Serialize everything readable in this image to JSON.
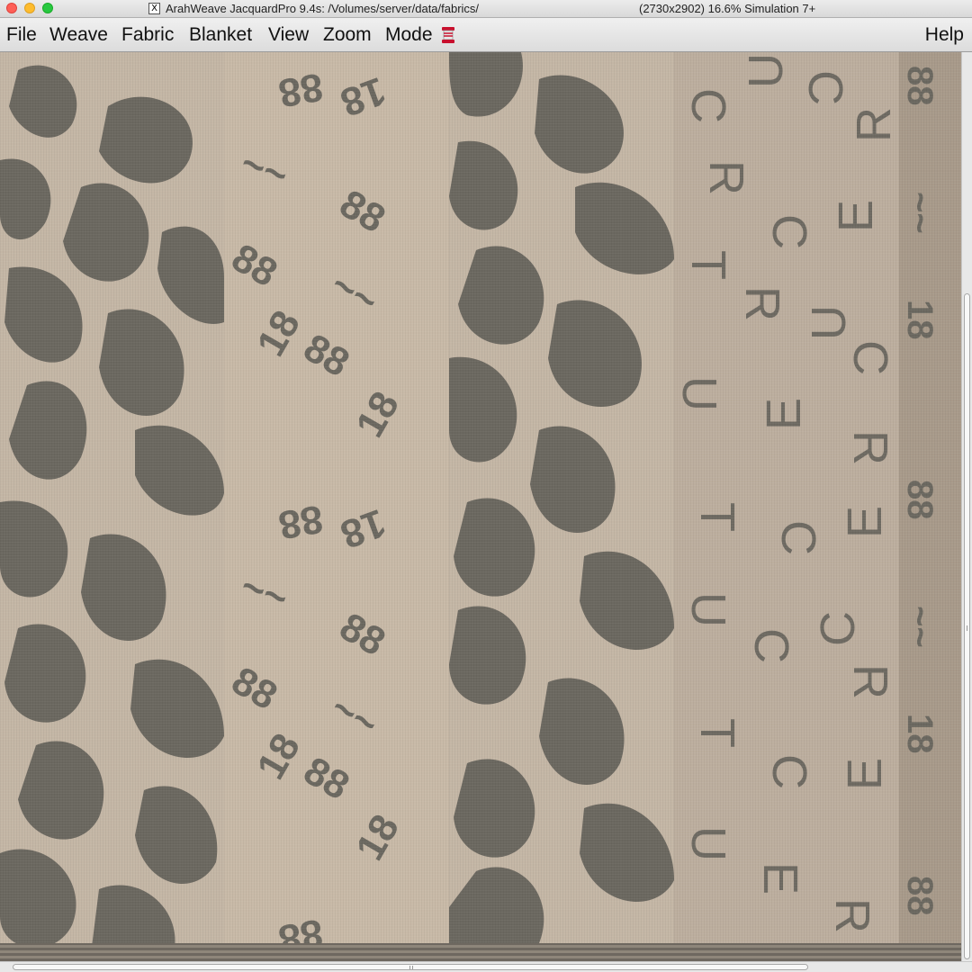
{
  "window": {
    "title_left": "ArahWeave JacquardPro 9.4s: /Volumes/server/data/fabrics/",
    "title_right": "(2730x2902) 16.6% Simulation 7+",
    "app_icon": "x11-icon",
    "app_icon_glyph": "X"
  },
  "menu": {
    "file": "File",
    "weave": "Weave",
    "fabric": "Fabric",
    "blanket": "Blanket",
    "view": "View",
    "zoom": "Zoom",
    "mode": "Mode",
    "help": "Help",
    "mode_icon": "thread-spool-icon"
  },
  "fabric": {
    "stripes": [
      {
        "pattern": "leaves",
        "ground": "#c4b6a5",
        "figure": "#6b6860"
      },
      {
        "pattern": "numerals",
        "ground": "#c8b9a7",
        "figure": "#6b6860"
      },
      {
        "pattern": "leaves",
        "ground": "#c4b6a5",
        "figure": "#6b6860"
      },
      {
        "pattern": "letters",
        "ground": "#bcae9e",
        "figure": "#6e6a62"
      },
      {
        "pattern": "numerals-speckled",
        "ground": "#a89a8a",
        "figure": "#6b6860"
      }
    ],
    "motif_text_numerals": "18",
    "motif_text_eights": "88",
    "motif_letters": [
      "U",
      "R",
      "T",
      "C",
      "E",
      "8",
      "/",
      "—",
      "8"
    ]
  },
  "colors": {
    "ground": "#c4b6a5",
    "figure": "#6b6860",
    "menubar": "#e4e4e4"
  }
}
